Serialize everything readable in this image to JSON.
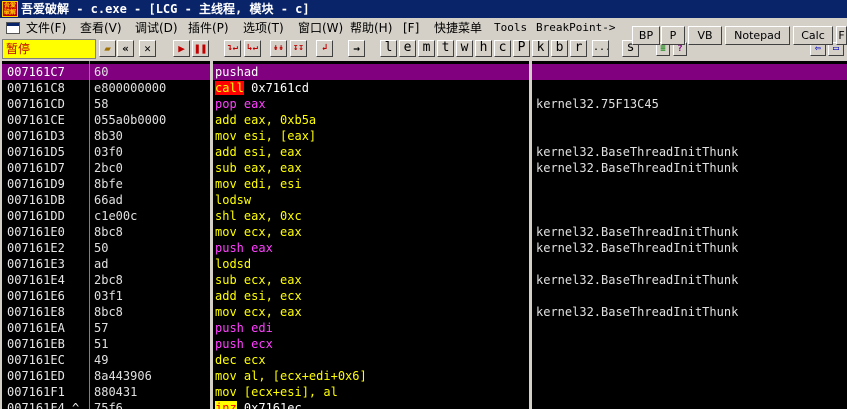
{
  "window": {
    "app_icon_text": "吾爱破解",
    "title": "吾爱破解 - c.exe - [LCG -  主线程, 模块 - c]"
  },
  "menu": {
    "items": [
      {
        "label": "文件(F)"
      },
      {
        "label": "查看(V)"
      },
      {
        "label": "调试(D)"
      },
      {
        "label": "插件(P)"
      },
      {
        "label": "选项(T)"
      },
      {
        "label": "窗口(W)"
      },
      {
        "label": "帮助(H)"
      },
      {
        "label": "[F]"
      },
      {
        "label": "快捷菜单"
      },
      {
        "label": "Tools"
      },
      {
        "label": "BreakPoint->"
      }
    ]
  },
  "right_buttons": [
    {
      "label": "BP"
    },
    {
      "label": "P"
    },
    {
      "label": "VB"
    },
    {
      "label": "Notepad"
    },
    {
      "label": "Calc"
    },
    {
      "label": "F"
    }
  ],
  "toolbar": {
    "status": "暂停",
    "letters": [
      "l",
      "e",
      "m",
      "t",
      "w",
      "h",
      "c",
      "P",
      "k",
      "b",
      "r",
      "...",
      "s"
    ]
  },
  "disasm": [
    {
      "addr": "007161C7",
      "hex": "60",
      "op": "pushad",
      "args": "",
      "opstyle": "w",
      "cmt": "",
      "selected": true
    },
    {
      "addr": "007161C8",
      "hex": "e800000000",
      "op": "call",
      "args": " 0x7161cd",
      "opstyle": "red",
      "cmt": ""
    },
    {
      "addr": "007161CD",
      "hex": "58",
      "op": "pop",
      "args": " eax",
      "opstyle": "m",
      "cmt": "kernel32.75F13C45"
    },
    {
      "addr": "007161CE",
      "hex": "055a0b0000",
      "op": "add",
      "args": " eax, 0xb5a",
      "opstyle": "y",
      "cmt": ""
    },
    {
      "addr": "007161D3",
      "hex": "8b30",
      "op": "mov",
      "args": " esi, [eax]",
      "opstyle": "y",
      "cmt": ""
    },
    {
      "addr": "007161D5",
      "hex": "03f0",
      "op": "add",
      "args": " esi, eax",
      "opstyle": "y",
      "cmt": "kernel32.BaseThreadInitThunk"
    },
    {
      "addr": "007161D7",
      "hex": "2bc0",
      "op": "sub",
      "args": " eax, eax",
      "opstyle": "y",
      "cmt": "kernel32.BaseThreadInitThunk"
    },
    {
      "addr": "007161D9",
      "hex": "8bfe",
      "op": "mov",
      "args": " edi, esi",
      "opstyle": "y",
      "cmt": ""
    },
    {
      "addr": "007161DB",
      "hex": "66ad",
      "op": "lodsw",
      "args": "",
      "opstyle": "y",
      "cmt": ""
    },
    {
      "addr": "007161DD",
      "hex": "c1e00c",
      "op": "shl",
      "args": " eax, 0xc",
      "opstyle": "y",
      "cmt": ""
    },
    {
      "addr": "007161E0",
      "hex": "8bc8",
      "op": "mov",
      "args": " ecx, eax",
      "opstyle": "y",
      "cmt": "kernel32.BaseThreadInitThunk"
    },
    {
      "addr": "007161E2",
      "hex": "50",
      "op": "push",
      "args": " eax",
      "opstyle": "m",
      "cmt": "kernel32.BaseThreadInitThunk"
    },
    {
      "addr": "007161E3",
      "hex": "ad",
      "op": "lodsd",
      "args": "",
      "opstyle": "y",
      "cmt": ""
    },
    {
      "addr": "007161E4",
      "hex": "2bc8",
      "op": "sub",
      "args": " ecx, eax",
      "opstyle": "y",
      "cmt": "kernel32.BaseThreadInitThunk"
    },
    {
      "addr": "007161E6",
      "hex": "03f1",
      "op": "add",
      "args": " esi, ecx",
      "opstyle": "y",
      "cmt": ""
    },
    {
      "addr": "007161E8",
      "hex": "8bc8",
      "op": "mov",
      "args": " ecx, eax",
      "opstyle": "y",
      "cmt": "kernel32.BaseThreadInitThunk"
    },
    {
      "addr": "007161EA",
      "hex": "57",
      "op": "push",
      "args": " edi",
      "opstyle": "m",
      "cmt": ""
    },
    {
      "addr": "007161EB",
      "hex": "51",
      "op": "push",
      "args": " ecx",
      "opstyle": "m",
      "cmt": ""
    },
    {
      "addr": "007161EC",
      "hex": "49",
      "op": "dec",
      "args": " ecx",
      "opstyle": "y",
      "cmt": ""
    },
    {
      "addr": "007161ED",
      "hex": "8a443906",
      "op": "mov",
      "args": " al, [ecx+edi+0x6]",
      "opstyle": "y",
      "cmt": ""
    },
    {
      "addr": "007161F1",
      "hex": "880431",
      "op": "mov",
      "args": " [ecx+esi], al",
      "opstyle": "y",
      "cmt": ""
    },
    {
      "addr": "007161F4",
      "hex": "75f6",
      "op": "jnz",
      "args": " 0x7161ec",
      "opstyle": "yel",
      "cmt": "",
      "marker": "^"
    }
  ]
}
